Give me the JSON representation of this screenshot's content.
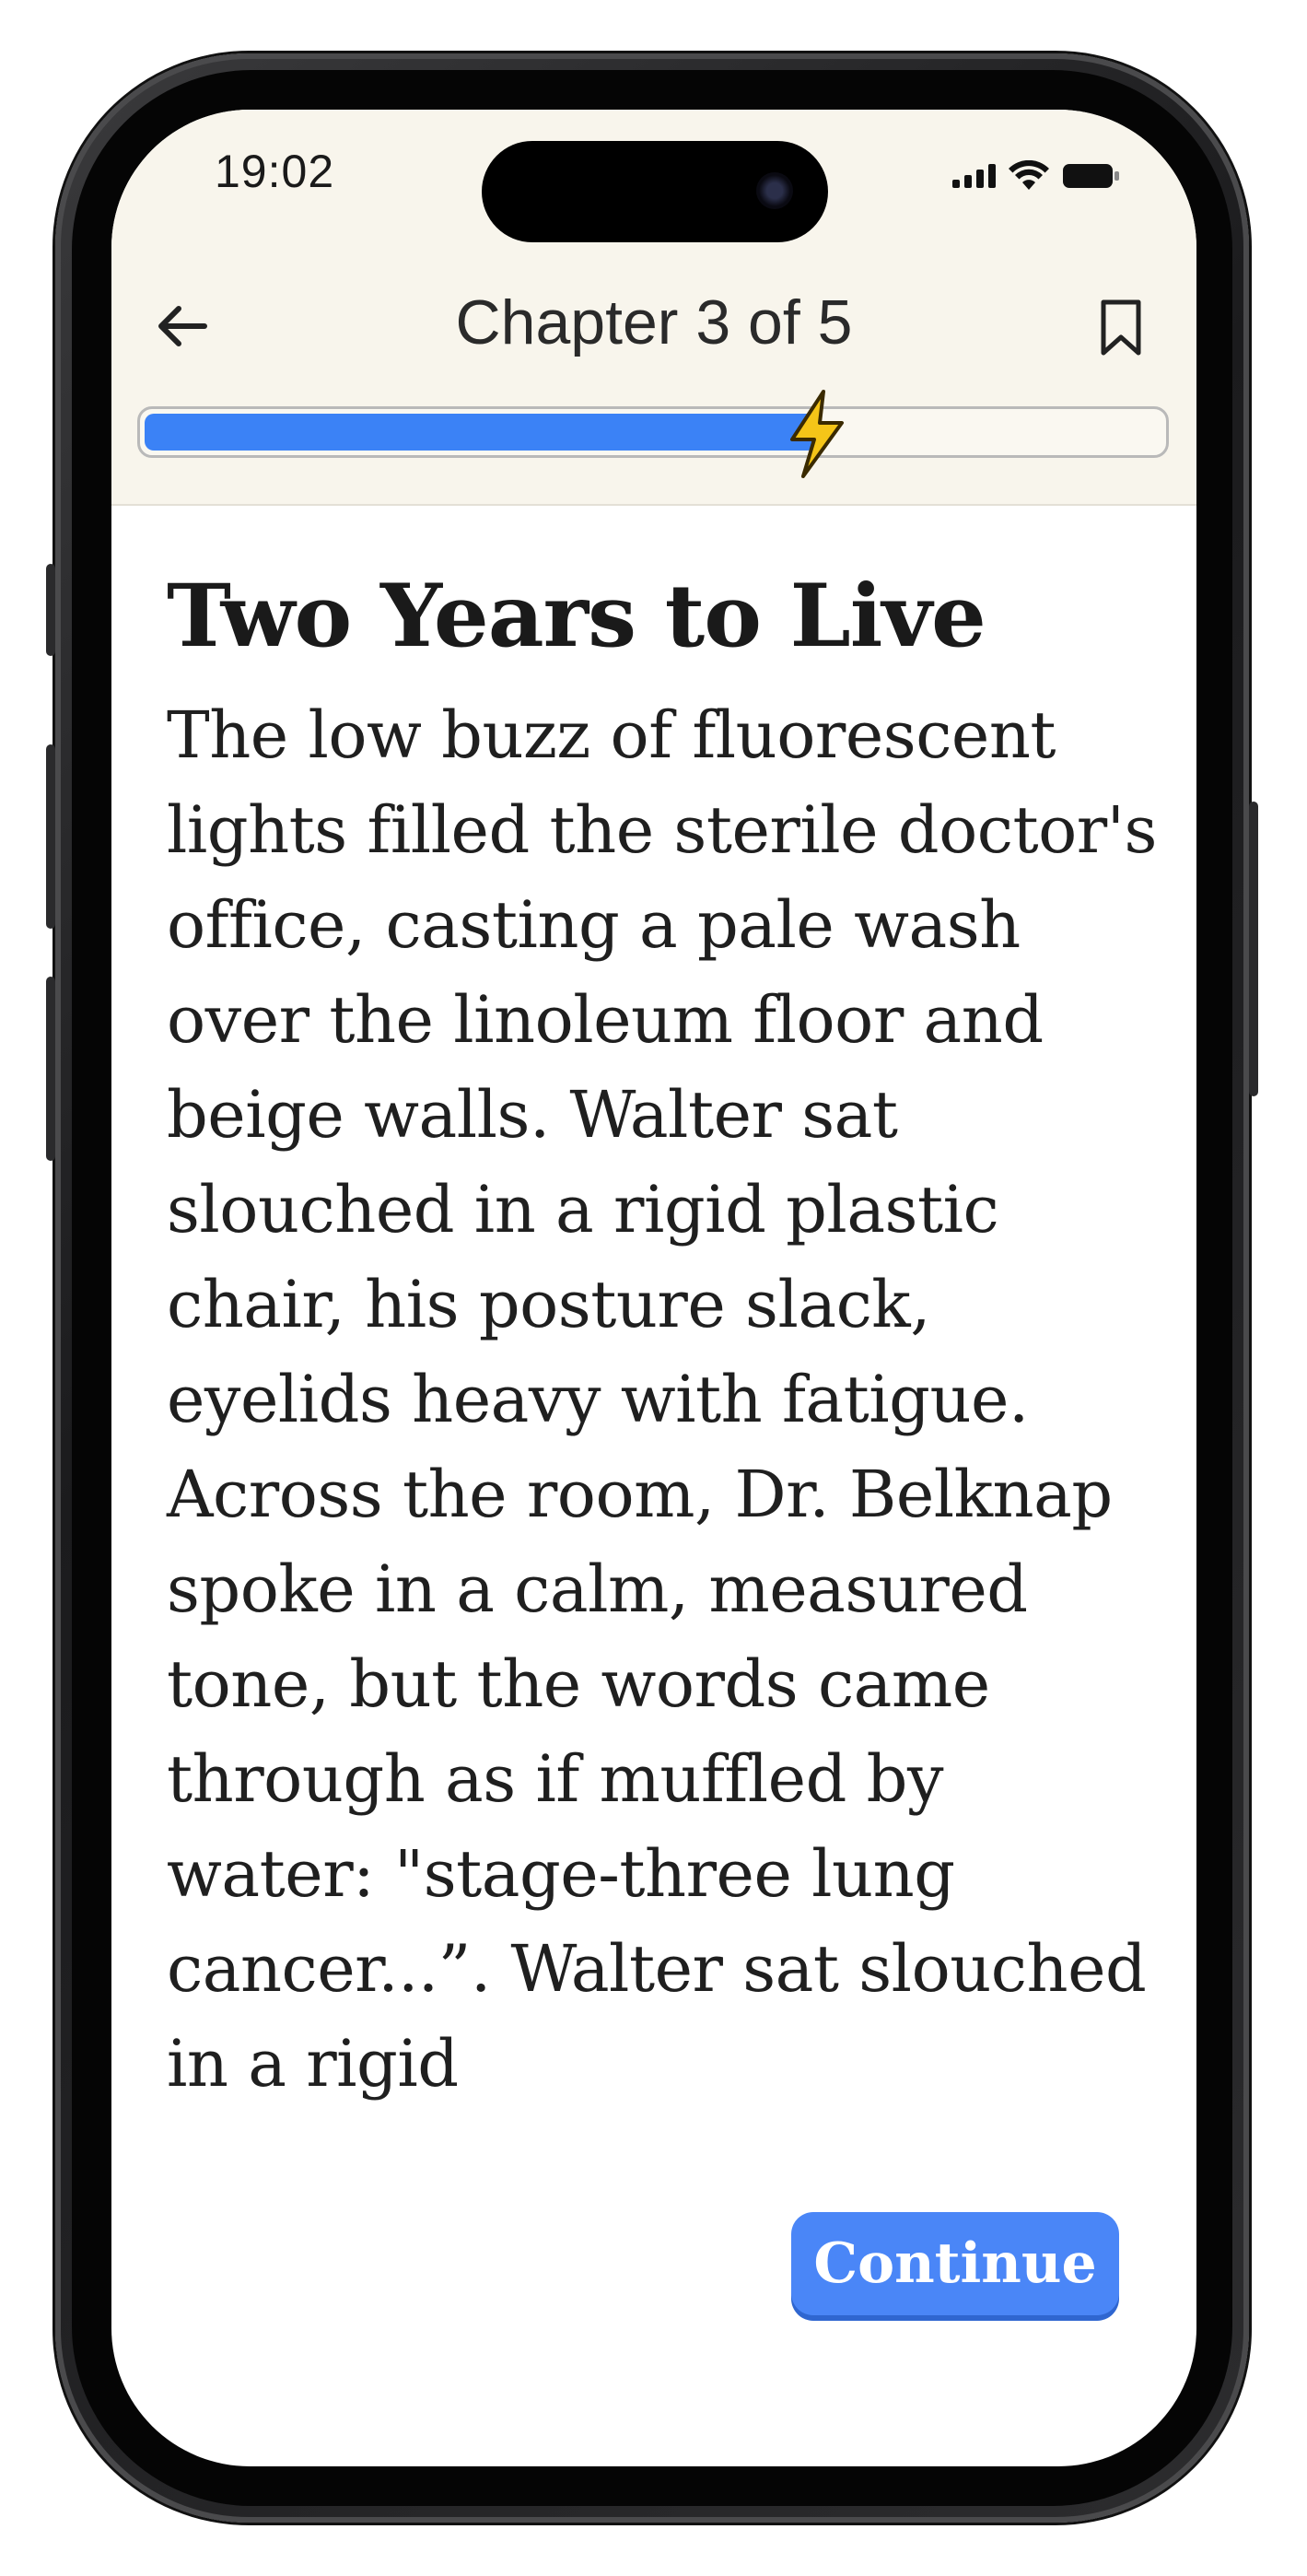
{
  "status_bar": {
    "time": "19:02",
    "signal_icon": "cellular-signal-icon",
    "wifi_icon": "wifi-icon",
    "battery_icon": "battery-icon"
  },
  "header": {
    "back_icon": "arrow-left-icon",
    "title": "Chapter 3 of 5",
    "bookmark_icon": "bookmark-icon"
  },
  "progress": {
    "fraction": 0.66,
    "marker_icon": "lightning-bolt-icon",
    "fill_color": "#3b82f6",
    "marker_color": "#f5c518"
  },
  "story": {
    "title": "Two Years to Live",
    "body": "The low buzz of fluorescent lights filled the sterile doctor's office, casting a pale wash over the linoleum floor and beige walls. Walter sat slouched in a rigid plastic chair, his posture slack, eyelids heavy with fatigue. Across the room, Dr. Belknap spoke in a calm, measured tone, but the words came through as if muffled by water: \"stage-three lung cancer...”. Walter sat slouched in a rigid"
  },
  "actions": {
    "continue_label": "Continue",
    "continue_color": "#4a86f7"
  }
}
